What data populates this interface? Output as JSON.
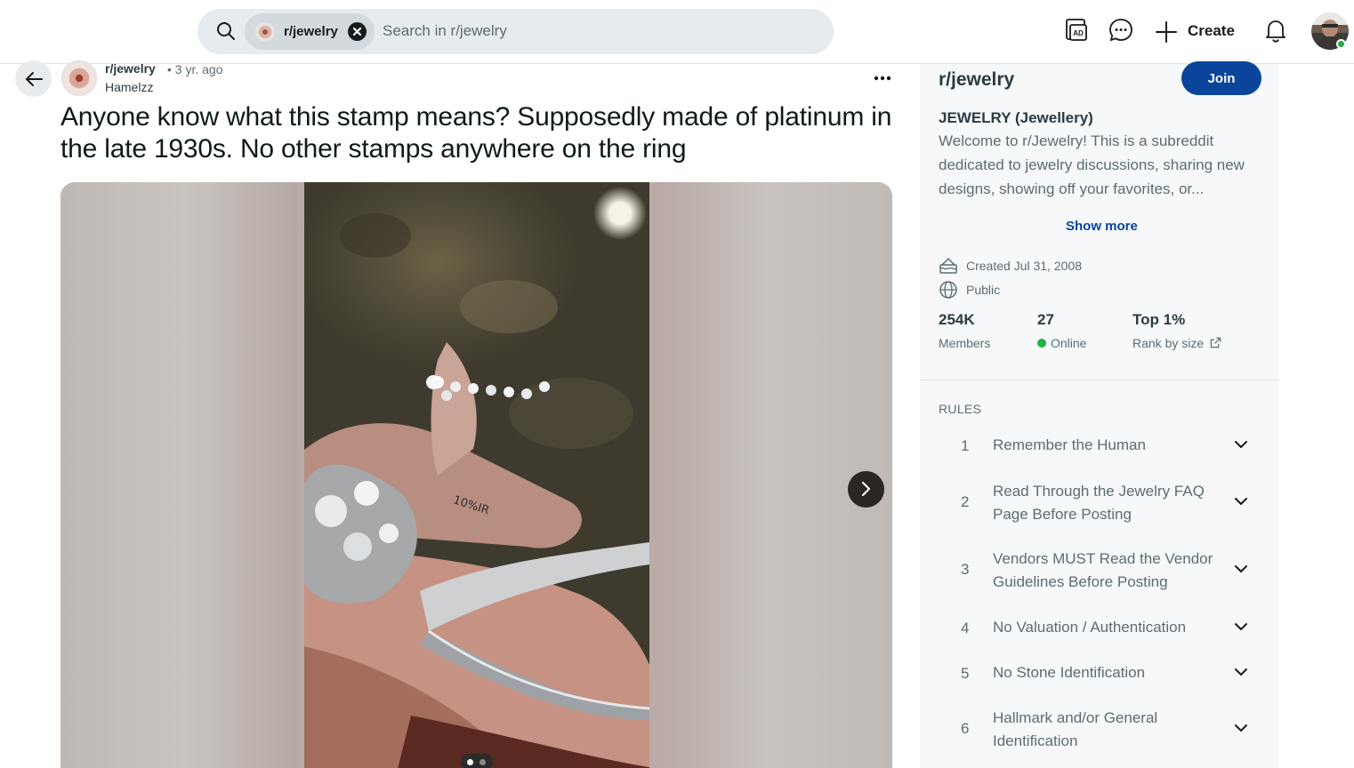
{
  "header": {
    "search_chip_label": "r/jewelry",
    "search_placeholder": "Search in r/jewelry",
    "create_label": "Create"
  },
  "post": {
    "subreddit": "r/jewelry",
    "time": "• 3 yr. ago",
    "author": "Hamelzz",
    "title": "Anyone know what this stamp means? Supposedly made of platinum in the late 1930s. No other stamps anywhere on the ring",
    "stamp_text": "10%IR"
  },
  "sidebar": {
    "title": "r/jewelry",
    "join_label": "Join",
    "full_name": "JEWELRY (Jewellery)",
    "description": "Welcome to r/Jewelry! This is a subreddit dedicated to jewelry discussions, sharing new designs, showing off your favorites, or...",
    "show_more": "Show more",
    "created": "Created Jul 31, 2008",
    "visibility": "Public",
    "stats": {
      "members_value": "254K",
      "members_label": "Members",
      "online_value": "27",
      "online_label": "Online",
      "rank_value": "Top 1%",
      "rank_label": "Rank by size"
    },
    "rules_heading": "RULES",
    "rules": [
      {
        "num": "1",
        "text": "Remember the Human"
      },
      {
        "num": "2",
        "text": "Read Through the Jewelry FAQ Page Before Posting"
      },
      {
        "num": "3",
        "text": "Vendors MUST Read the Vendor Guidelines Before Posting"
      },
      {
        "num": "4",
        "text": "No Valuation / Authentication"
      },
      {
        "num": "5",
        "text": "No Stone Identification"
      },
      {
        "num": "6",
        "text": "Hallmark and/or General Identification"
      }
    ]
  },
  "colors": {
    "join_button": "#0a449b",
    "online_dot": "#1fb341",
    "search_bg": "#e5ebee"
  }
}
